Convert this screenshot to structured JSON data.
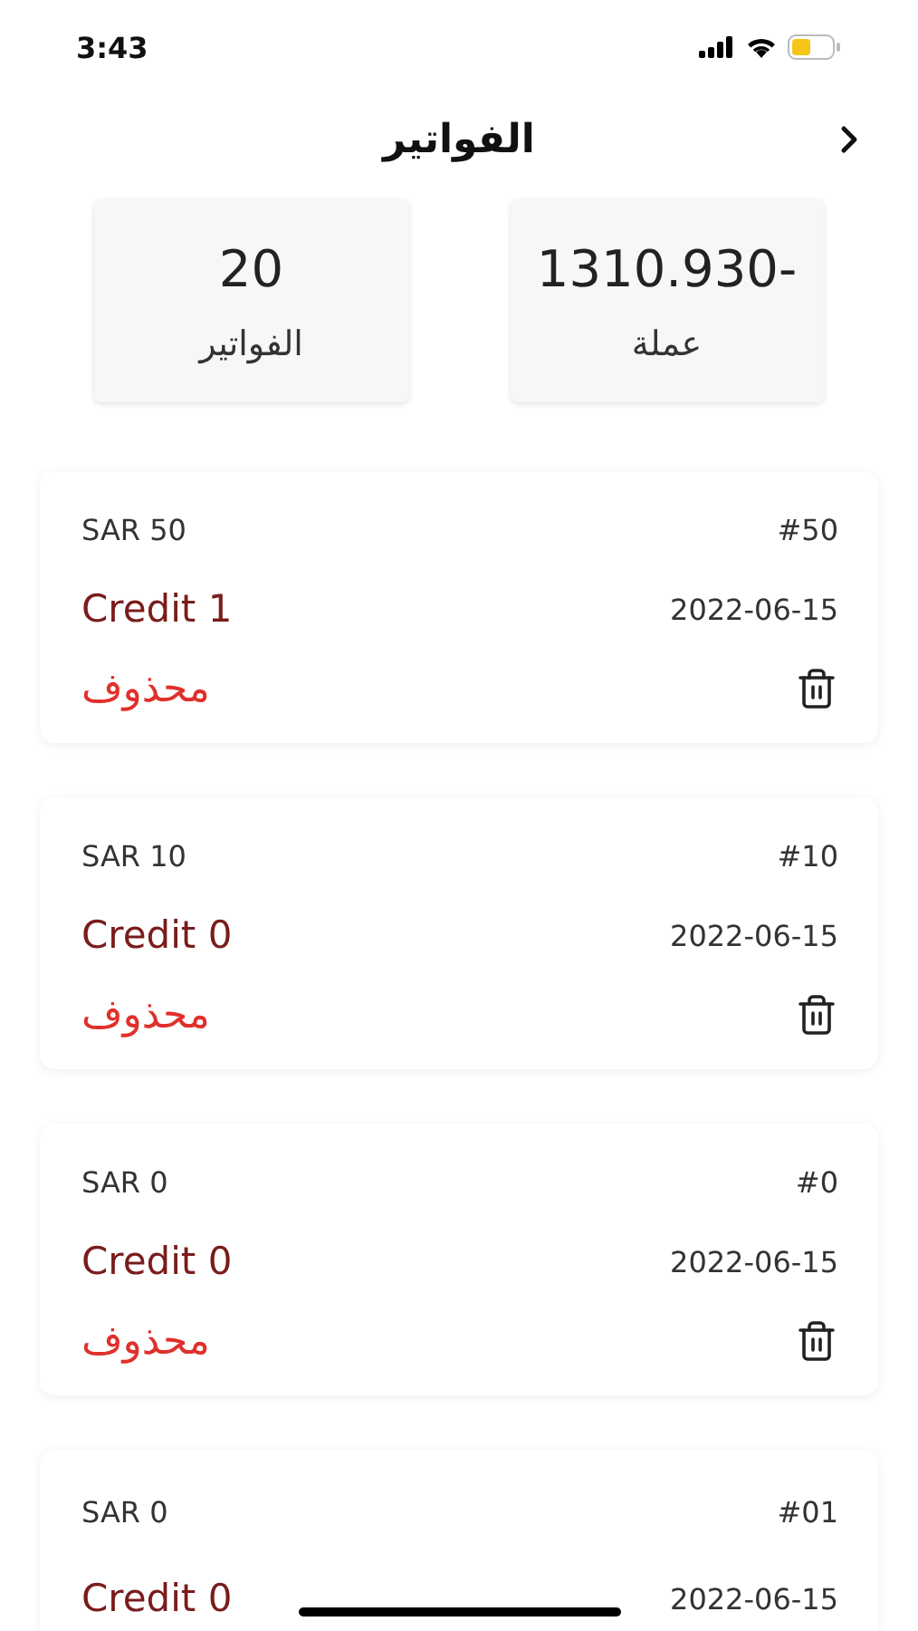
{
  "status_bar": {
    "time": "3:43"
  },
  "header": {
    "title": "الفواتير"
  },
  "stats": {
    "invoice_count": {
      "value": "20",
      "label": "الفواتير"
    },
    "currency_total": {
      "value": "1310.930-",
      "label": "عملة"
    }
  },
  "invoices": [
    {
      "amount": "SAR 50",
      "number": "#50",
      "customer": "Credit 1",
      "date": "2022-06-15",
      "status": "محذوف"
    },
    {
      "amount": "SAR 10",
      "number": "#10",
      "customer": "Credit 0",
      "date": "2022-06-15",
      "status": "محذوف"
    },
    {
      "amount": "SAR 0",
      "number": "#0",
      "customer": "Credit 0",
      "date": "2022-06-15",
      "status": "محذوف"
    },
    {
      "amount": "SAR 0",
      "number": "#01",
      "customer": "Credit 0",
      "date": "2022-06-15"
    }
  ]
}
